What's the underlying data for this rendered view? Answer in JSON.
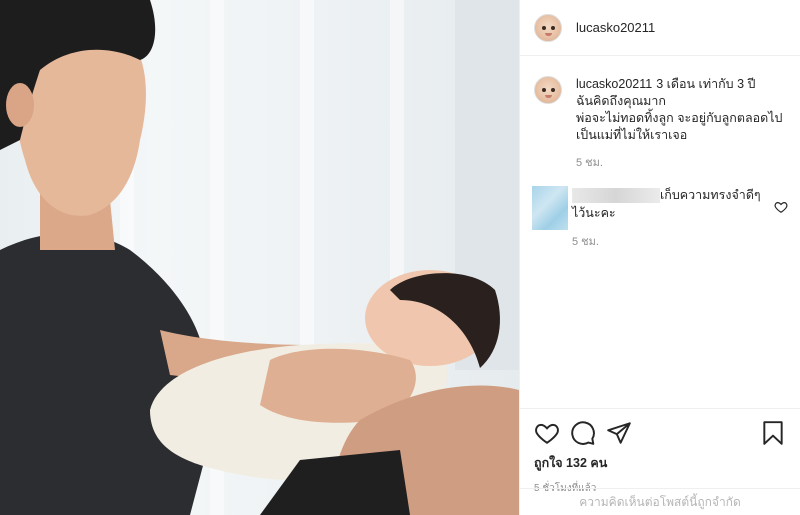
{
  "post": {
    "username": "lucasko20211",
    "caption": {
      "username": "lucasko20211",
      "text_line1": "3 เดือน เท่ากับ 3 ปี",
      "text_line2": "ฉันคิดถึงคุณมาก",
      "text_line3": "พ่อจะไม่ทอดทิ้งลูก จะอยู่กับลูกตลอดไป",
      "text_line4": "เป็นแม่ที่ไม่ให้เราเจอ",
      "time": "5 ชม."
    },
    "comment": {
      "text_line1": "เก็บความทรงจำดีๆ",
      "text_line2": "ไว้นะคะ",
      "time": "5 ชม."
    },
    "likes": "ถูกใจ 132 คน",
    "posted": "5 ชั่วโมงที่แล้ว",
    "comments_limited": "ความคิดเห็นต่อโพสต์นี้ถูกจำกัด"
  },
  "icons": {
    "like": "heart-icon",
    "comment": "comment-icon",
    "share": "paper-plane-icon",
    "save": "bookmark-icon"
  }
}
